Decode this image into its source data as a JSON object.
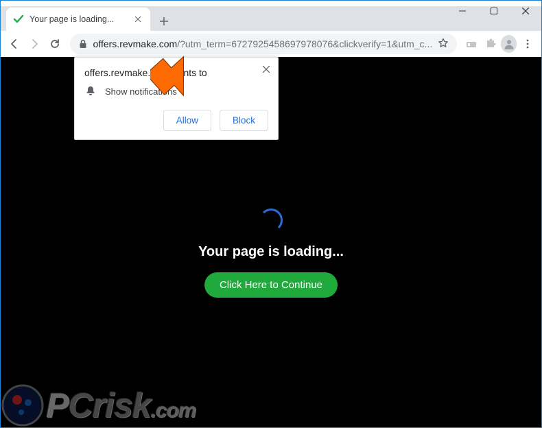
{
  "tab": {
    "title": "Your page is loading..."
  },
  "url": {
    "domain": "offers.revmake.com",
    "path": "/?utm_term=6727925458697978076&clickverify=1&utm_c..."
  },
  "permission": {
    "host": "offers.revmake.com wants to",
    "body": "Show notifications",
    "allow": "Allow",
    "block": "Block"
  },
  "page": {
    "heading": "Your page is loading...",
    "cta": "Click Here to Continue"
  },
  "watermark": {
    "p": "P",
    "crisk": "Crisk",
    "dotcom": ".com"
  },
  "colors": {
    "accent": "#1a73e8",
    "cta_bg": "#21aa3c",
    "arrow": "#fd6a02"
  }
}
